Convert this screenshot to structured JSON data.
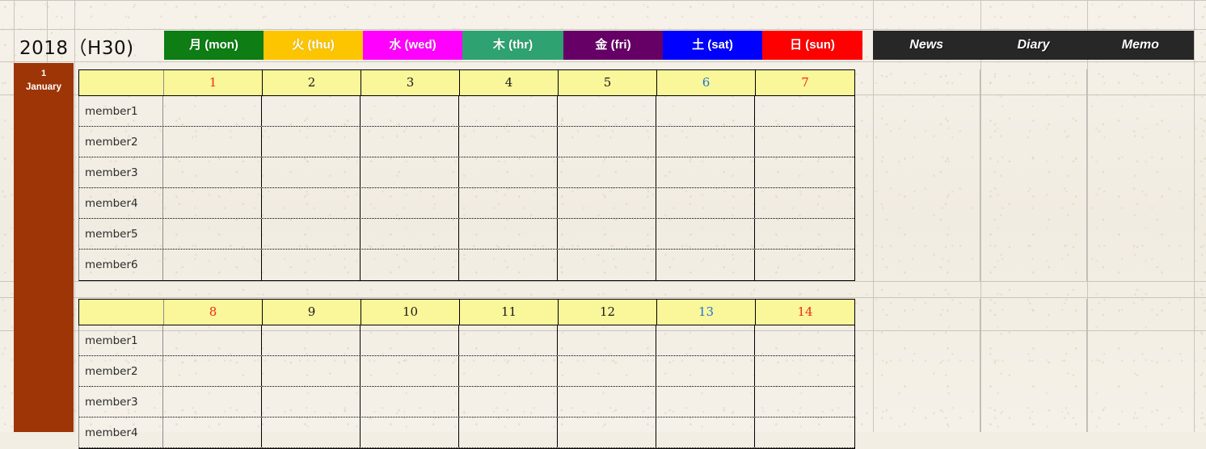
{
  "title": "2018（H30)",
  "month": {
    "number": "1",
    "name": "January"
  },
  "weekdays": [
    {
      "label": "月 (mon)",
      "color": "#0d7d14"
    },
    {
      "label": "火 (thu)",
      "color": "#fcc500"
    },
    {
      "label": "水 (wed)",
      "color": "#ff00ff"
    },
    {
      "label": "木 (thr)",
      "color": "#2fa271"
    },
    {
      "label": "金 (fri)",
      "color": "#660066"
    },
    {
      "label": "土 (sat)",
      "color": "#0000ff"
    },
    {
      "label": "日 (sun)",
      "color": "#ff0000"
    }
  ],
  "weeks": [
    {
      "dates": [
        {
          "n": "1",
          "kind": "hol"
        },
        {
          "n": "2",
          "kind": ""
        },
        {
          "n": "3",
          "kind": ""
        },
        {
          "n": "4",
          "kind": ""
        },
        {
          "n": "5",
          "kind": ""
        },
        {
          "n": "6",
          "kind": "sat"
        },
        {
          "n": "7",
          "kind": "sun"
        }
      ],
      "members": [
        "member1",
        "member2",
        "member3",
        "member4",
        "member5",
        "member6"
      ]
    },
    {
      "dates": [
        {
          "n": "8",
          "kind": "hol"
        },
        {
          "n": "9",
          "kind": ""
        },
        {
          "n": "10",
          "kind": ""
        },
        {
          "n": "11",
          "kind": ""
        },
        {
          "n": "12",
          "kind": ""
        },
        {
          "n": "13",
          "kind": "sat"
        },
        {
          "n": "14",
          "kind": "sun"
        }
      ],
      "members": [
        "member1",
        "member2",
        "member3",
        "member4"
      ]
    }
  ],
  "panels": [
    "News",
    "Diary",
    "Memo"
  ],
  "colors": {
    "month_spine": "#9e3507",
    "date_row_bg": "#faf69a",
    "panel_header_bg": "#272727",
    "saturday_text": "#1d74d6",
    "sunday_text": "#ef2d16"
  }
}
